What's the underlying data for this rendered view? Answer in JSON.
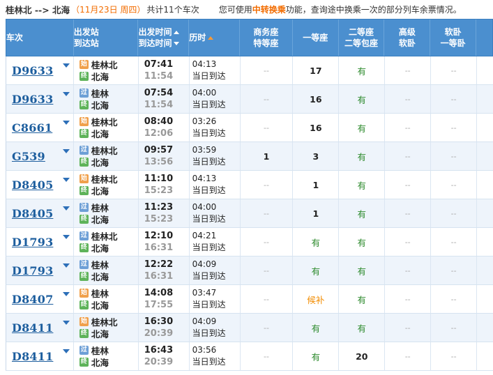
{
  "topbar": {
    "route": "桂林北 --> 北海",
    "date": "（11月23日 周四）",
    "count": "共计11个车次",
    "tip_prefix": "您可使用",
    "tip_link": "中转换乘",
    "tip_suffix": "功能，查询途中换乘一次的部分列车余票情况。"
  },
  "header": {
    "train": "车次",
    "station_1": "出发站",
    "station_2": "到达站",
    "time_1": "出发时间",
    "time_2": "到达时间",
    "duration": "历时",
    "biz_1": "商务座",
    "biz_2": "特等座",
    "first": "一等座",
    "second_1": "二等座",
    "second_2": "二等包座",
    "adv_1": "高级",
    "adv_2": "软卧",
    "soft_1": "软卧",
    "soft_2": "一等卧"
  },
  "colors": {
    "header_bg": "#4b8fcf",
    "train_link": "#1d5e9e",
    "available": "#2e8b2e",
    "waitlist": "#f28c00",
    "start_badge": "#f0a04b",
    "pass_badge": "#6d9fd6",
    "end_badge": "#5eb35a"
  },
  "badges": {
    "start": "始",
    "pass": "过",
    "end": "终"
  },
  "rows": [
    {
      "train": "D9633",
      "from": "桂林北",
      "from_type": "start",
      "to": "北海",
      "dep": "07:41",
      "arr": "11:54",
      "dur": "04:13",
      "day": "当日到达",
      "biz": "--",
      "first": "17",
      "second": "有",
      "adv": "--",
      "soft": "--"
    },
    {
      "train": "D9633",
      "from": "桂林",
      "from_type": "pass",
      "to": "北海",
      "dep": "07:54",
      "arr": "11:54",
      "dur": "04:00",
      "day": "当日到达",
      "biz": "--",
      "first": "16",
      "second": "有",
      "adv": "--",
      "soft": "--"
    },
    {
      "train": "C8661",
      "from": "桂林北",
      "from_type": "start",
      "to": "北海",
      "dep": "08:40",
      "arr": "12:06",
      "dur": "03:26",
      "day": "当日到达",
      "biz": "--",
      "first": "16",
      "second": "有",
      "adv": "--",
      "soft": "--"
    },
    {
      "train": "G539",
      "from": "桂林北",
      "from_type": "pass",
      "to": "北海",
      "dep": "09:57",
      "arr": "13:56",
      "dur": "03:59",
      "day": "当日到达",
      "biz": "1",
      "first": "3",
      "second": "有",
      "adv": "--",
      "soft": "--"
    },
    {
      "train": "D8405",
      "from": "桂林北",
      "from_type": "start",
      "to": "北海",
      "dep": "11:10",
      "arr": "15:23",
      "dur": "04:13",
      "day": "当日到达",
      "biz": "--",
      "first": "1",
      "second": "有",
      "adv": "--",
      "soft": "--"
    },
    {
      "train": "D8405",
      "from": "桂林",
      "from_type": "pass",
      "to": "北海",
      "dep": "11:23",
      "arr": "15:23",
      "dur": "04:00",
      "day": "当日到达",
      "biz": "--",
      "first": "1",
      "second": "有",
      "adv": "--",
      "soft": "--"
    },
    {
      "train": "D1793",
      "from": "桂林北",
      "from_type": "pass",
      "to": "北海",
      "dep": "12:10",
      "arr": "16:31",
      "dur": "04:21",
      "day": "当日到达",
      "biz": "--",
      "first": "有",
      "second": "有",
      "adv": "--",
      "soft": "--"
    },
    {
      "train": "D1793",
      "from": "桂林",
      "from_type": "pass",
      "to": "北海",
      "dep": "12:22",
      "arr": "16:31",
      "dur": "04:09",
      "day": "当日到达",
      "biz": "--",
      "first": "有",
      "second": "有",
      "adv": "--",
      "soft": "--"
    },
    {
      "train": "D8407",
      "from": "桂林",
      "from_type": "start",
      "to": "北海",
      "dep": "14:08",
      "arr": "17:55",
      "dur": "03:47",
      "day": "当日到达",
      "biz": "--",
      "first": "候补",
      "second": "有",
      "adv": "--",
      "soft": "--"
    },
    {
      "train": "D8411",
      "from": "桂林北",
      "from_type": "start",
      "to": "北海",
      "dep": "16:30",
      "arr": "20:39",
      "dur": "04:09",
      "day": "当日到达",
      "biz": "--",
      "first": "有",
      "second": "有",
      "adv": "--",
      "soft": "--"
    },
    {
      "train": "D8411",
      "from": "桂林",
      "from_type": "pass",
      "to": "北海",
      "dep": "16:43",
      "arr": "20:39",
      "dur": "03:56",
      "day": "当日到达",
      "biz": "--",
      "first": "有",
      "second": "20",
      "adv": "--",
      "soft": "--"
    }
  ]
}
